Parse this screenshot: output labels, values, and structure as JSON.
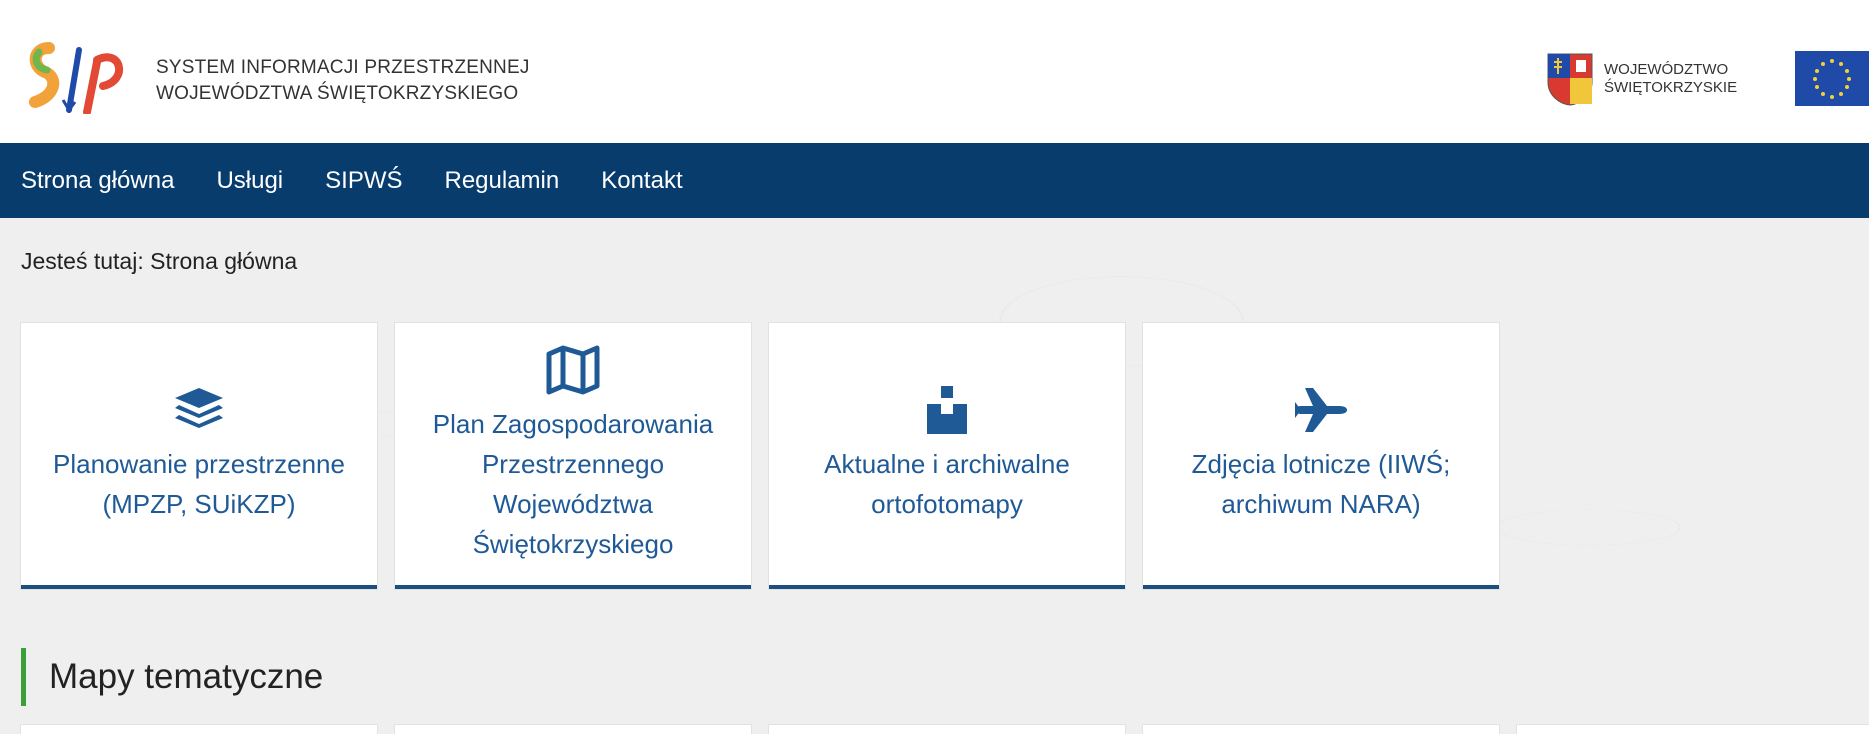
{
  "header": {
    "logo_text_line1": "SYSTEM INFORMACJI PRZESTRZENNEJ",
    "logo_text_line2": "WOJEWÓDZTWA ŚWIĘTOKRZYSKIEGO",
    "region_line1": "WOJEWÓDZTWO",
    "region_line2": "ŚWIĘTOKRZYSKIE"
  },
  "nav": {
    "items": [
      "Strona główna",
      "Usługi",
      "SIPWŚ",
      "Regulamin",
      "Kontakt"
    ]
  },
  "breadcrumb": "Jesteś tutaj: Strona główna",
  "tiles": [
    {
      "icon": "layers-icon",
      "label": "Planowanie przestrzenne (MPZP, SUiKZP)"
    },
    {
      "icon": "map-icon",
      "label": "Plan Zagospodarowania Przestrzennego Województwa Świętokrzyskiego"
    },
    {
      "icon": "ortho-icon",
      "label": "Aktualne i archiwalne ortofotomapy"
    },
    {
      "icon": "plane-icon",
      "label": "Zdjęcia lotnicze (IIWŚ; archiwum NARA)"
    }
  ],
  "section": {
    "title": "Mapy tematyczne"
  },
  "colors": {
    "nav_bg": "#073c6d",
    "tile_accent": "#1c4f80",
    "tile_text": "#1f5a97",
    "section_accent": "#3aa03a"
  }
}
